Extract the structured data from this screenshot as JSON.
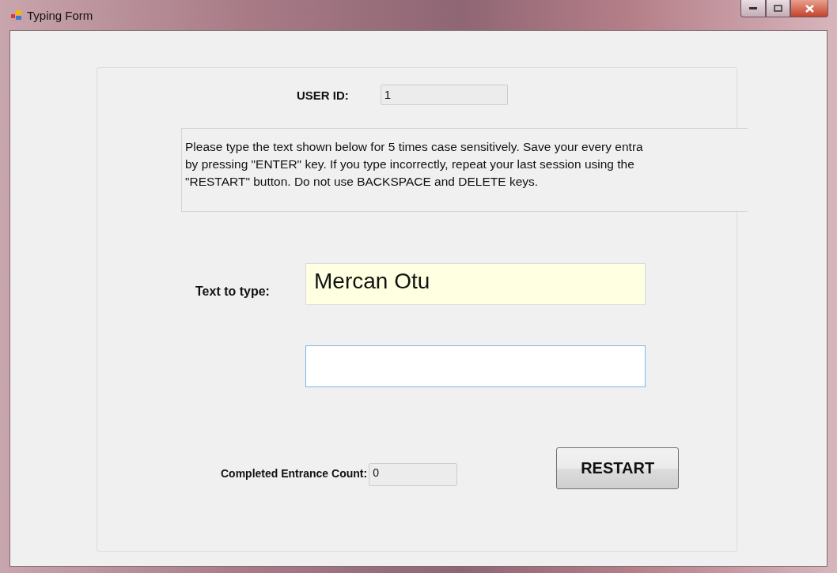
{
  "window": {
    "title": "Typing Form"
  },
  "user_id": {
    "label": "USER ID:",
    "value": "1"
  },
  "instructions": [
    "Please type the text shown below for 5 times case sensitively. Save your every entra",
    "by pressing \"ENTER\" key. If you type incorrectly, repeat your last session using the",
    "\"RESTART\" button. Do not use BACKSPACE and DELETE keys."
  ],
  "text_to_type": {
    "label": "Text to type:",
    "value": "Mercan Otu"
  },
  "count": {
    "label": "Completed Entrance Count:",
    "value": "0"
  },
  "buttons": [
    "RESTART"
  ]
}
